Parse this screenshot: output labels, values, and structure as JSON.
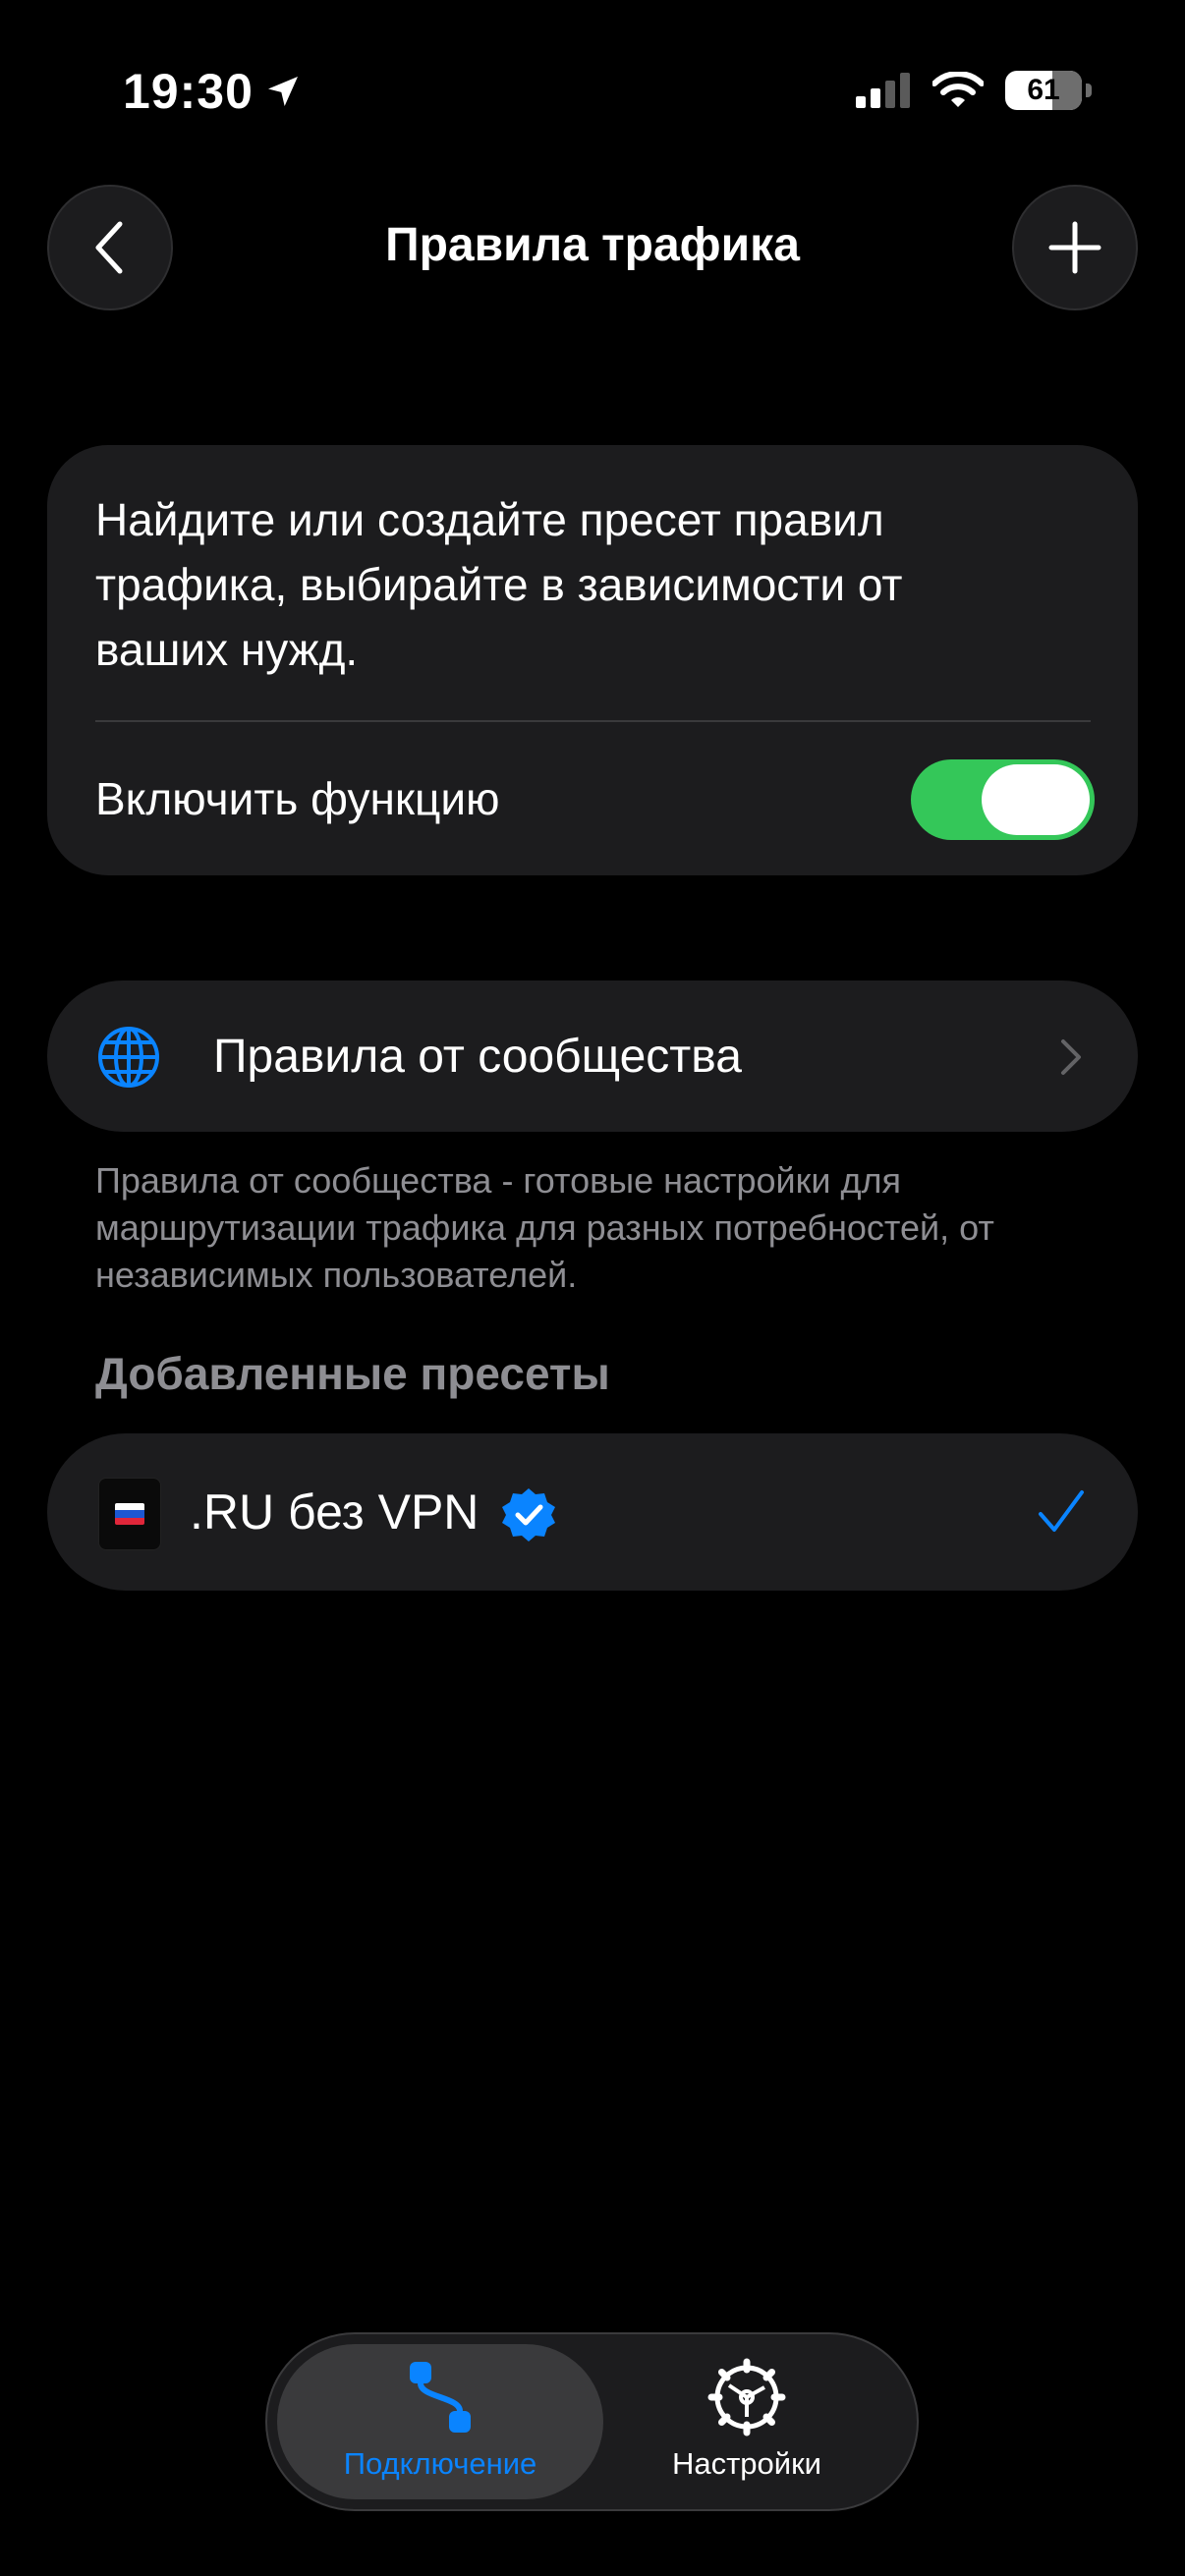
{
  "status_bar": {
    "time": "19:30",
    "battery": "61"
  },
  "nav": {
    "title": "Правила трафика"
  },
  "info_card": {
    "description": "Найдите или создайте пресет правил трафика, выбирайте в зависимости от ваших нужд.",
    "toggle_label": "Включить функцию",
    "toggle_on": true
  },
  "community": {
    "label": "Правила от сообщества",
    "footnote": "Правила от сообщества - готовые настройки для маршрутизации трафика для разных потребностей, от независимых пользователей."
  },
  "presets": {
    "section_title": "Добавленные пресеты",
    "items": [
      {
        "name": ".RU без VPN",
        "verified": true,
        "selected": true
      }
    ]
  },
  "tabbar": {
    "tabs": [
      {
        "label": "Подключение",
        "active": true
      },
      {
        "label": "Настройки",
        "active": false
      }
    ]
  },
  "colors": {
    "accent": "#0a84ff",
    "toggle_on": "#34c759",
    "card": "#1c1c1e",
    "secondary_text": "#8e8e93"
  }
}
